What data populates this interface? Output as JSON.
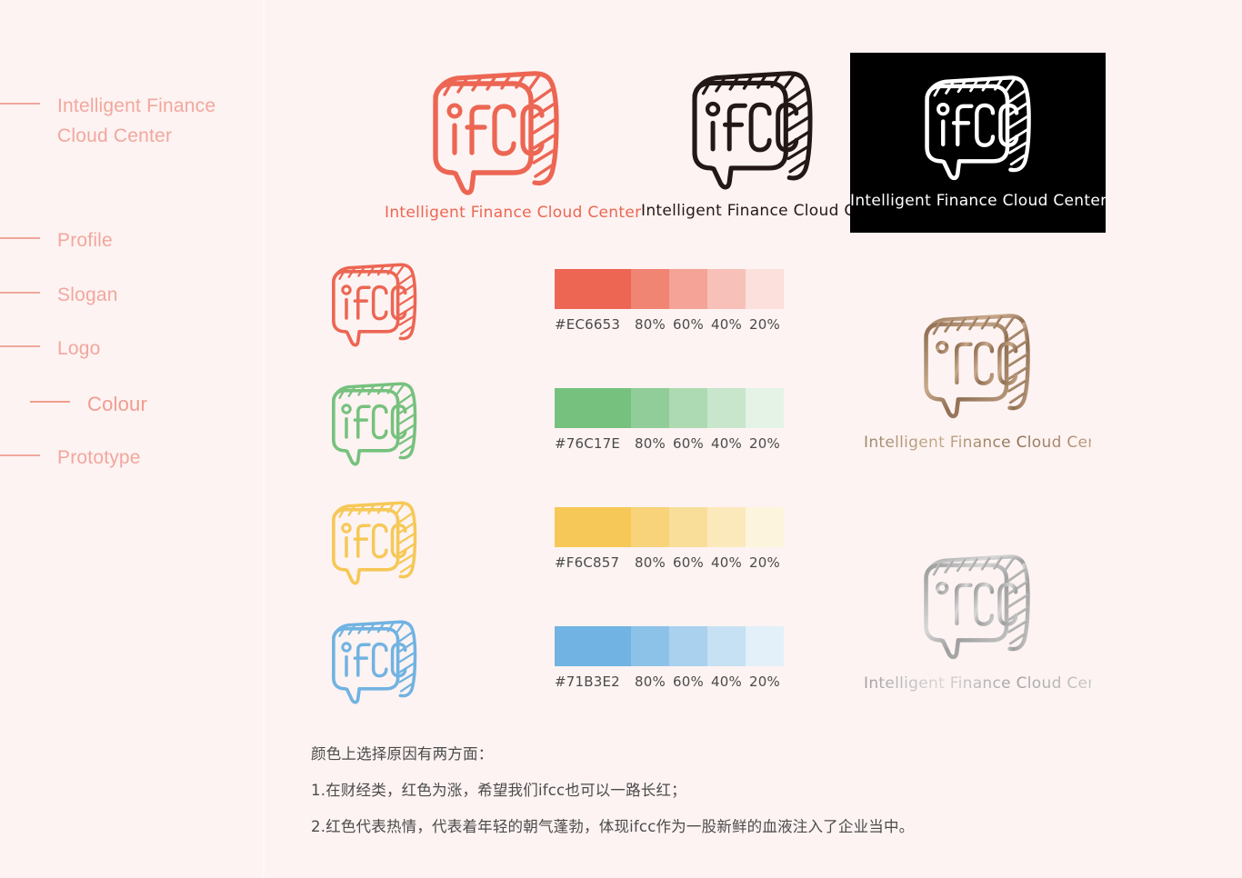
{
  "page": {
    "background_color": "#FDF3F2",
    "divider_color": "#FDF8F8"
  },
  "sidebar": {
    "accent_color": "#F2A79D",
    "items": [
      {
        "label": "Intelligent Finance Cloud Center",
        "active": false
      },
      {
        "label": "Profile",
        "active": false
      },
      {
        "label": "Slogan",
        "active": false
      },
      {
        "label": "Logo",
        "active": false
      },
      {
        "label": "Colour",
        "active": true
      },
      {
        "label": "Prototype",
        "active": false
      }
    ]
  },
  "logo": {
    "mark_text": "iFCC",
    "wordmark": "Intelligent Finance Cloud Center",
    "variants": [
      {
        "name": "primary-red",
        "color": "#EC6653",
        "wordmark_color": "#EC6653",
        "background": "#FDF3F2"
      },
      {
        "name": "black",
        "color": "#231815",
        "wordmark_color": "#231815",
        "background": "#FDF3F2"
      },
      {
        "name": "reversed-white",
        "color": "#FFFFFF",
        "wordmark_color": "#FFFFFF",
        "background": "#000000"
      },
      {
        "name": "bronze-gradient",
        "color": "#9C7B5E",
        "wordmark_color": "#9C7B5E",
        "background": "#FDF3F2"
      },
      {
        "name": "silver-gradient",
        "color": "#A8A8A8",
        "wordmark_color": "#A8A8A8",
        "background": "#FDF3F2"
      }
    ]
  },
  "colour_rows": [
    {
      "swatch_logo_color": "#EC6653",
      "hex": "#EC6653",
      "tints": [
        "80%",
        "60%",
        "40%",
        "20%"
      ],
      "tint_colors": [
        "#F08574",
        "#F4A396",
        "#F7C1B9",
        "#FBE0DB"
      ]
    },
    {
      "swatch_logo_color": "#76C17E",
      "hex": "#76C17E",
      "tints": [
        "80%",
        "60%",
        "40%",
        "20%"
      ],
      "tint_colors": [
        "#91CD98",
        "#ADDAB2",
        "#C8E6CB",
        "#E4F3E5"
      ]
    },
    {
      "swatch_logo_color": "#F6C857",
      "hex": "#F6C857",
      "tints": [
        "80%",
        "60%",
        "40%",
        "20%"
      ],
      "tint_colors": [
        "#F8D379",
        "#F9DE9A",
        "#FBE9BC",
        "#FDF4DD"
      ]
    },
    {
      "swatch_logo_color": "#71B3E2",
      "hex": "#71B3E2",
      "tints": [
        "80%",
        "60%",
        "40%",
        "20%"
      ],
      "tint_colors": [
        "#8DC2E8",
        "#AAD1EE",
        "#C6E1F3",
        "#E3F0F9"
      ]
    }
  ],
  "notes": {
    "heading": "颜色上选择原因有两方面：",
    "items": [
      "1.在财经类，红色为涨，希望我们ifcc也可以一路长红；",
      "2.红色代表热情，代表着年轻的朝气蓬勃，体现ifcc作为一股新鲜的血液注入了企业当中。"
    ]
  }
}
